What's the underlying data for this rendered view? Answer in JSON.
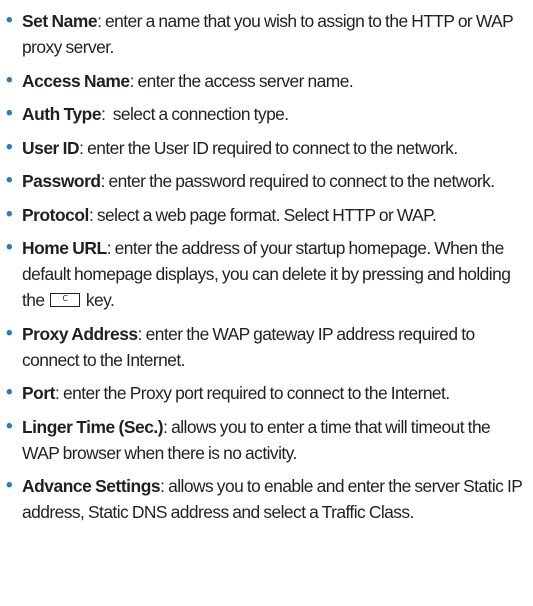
{
  "items": [
    {
      "term": "Set Name",
      "text": ": enter a name that you wish to assign to the HTTP or WAP proxy server."
    },
    {
      "term": "Access Name",
      "text": ": enter the access server name."
    },
    {
      "term": "Auth Type",
      "text": ":  select a connection type."
    },
    {
      "term": "User ID",
      "text": ": enter the User ID required to connect to the network."
    },
    {
      "term": "Password",
      "text": ": enter the password required to connect to the network."
    },
    {
      "term": "Protocol",
      "text": ": select a web page format. Select HTTP or WAP."
    },
    {
      "term": "Home URL",
      "text": ": enter the address of your startup homepage. When the default homepage displays, you can delete it by pressing and holding the",
      "key_label": "C",
      "text_after": " key."
    },
    {
      "term": "Proxy Address",
      "text": ": enter the WAP gateway IP address required to connect to the Internet."
    },
    {
      "term": "Port",
      "text": ": enter the Proxy port required to connect to the Internet."
    },
    {
      "term": "Linger Time (Sec.)",
      "text": ": allows you to enter a time that will timeout the WAP browser when there is no activity."
    },
    {
      "term": "Advance Settings",
      "text": ": allows you to enable and enter the server Static IP address, Static DNS address and select a Traffic Class."
    }
  ],
  "colors": {
    "bullet": "#2b7bc0",
    "text": "#231f20"
  },
  "bullet_glyph": "•"
}
